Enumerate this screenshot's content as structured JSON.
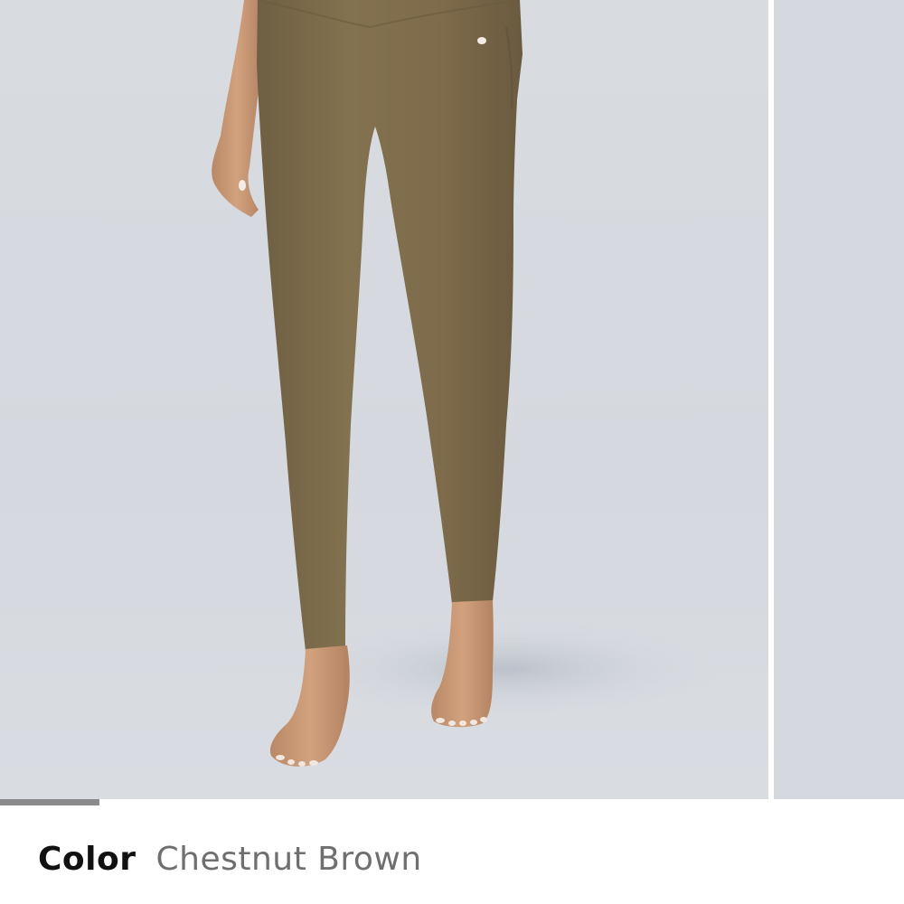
{
  "product_gallery": {
    "current_slide_image": "leggings-model-photo",
    "next_slide_image": "leggings-model-photo-next",
    "progress_fraction": 0.11
  },
  "color_selector": {
    "label": "Color",
    "value": "Chestnut Brown"
  },
  "colors": {
    "background": "#d7dbe0",
    "leggings": "#7e6d4e",
    "progress_bar": "#8a8a8a",
    "label_text": "#111111",
    "value_text": "#6f6f6f"
  }
}
